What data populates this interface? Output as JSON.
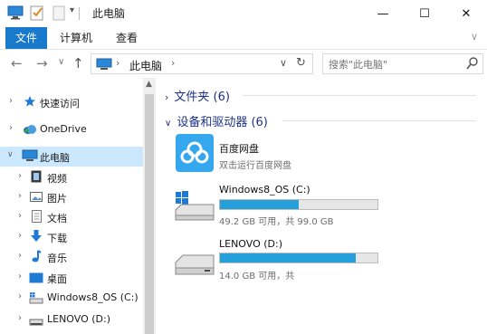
{
  "window": {
    "title": "此电脑",
    "controls": {
      "minimize": "—",
      "maximize": "☐",
      "close": "✕"
    }
  },
  "ribbon": {
    "tabs": [
      "文件",
      "计算机",
      "查看"
    ],
    "collapse_glyph": "∨"
  },
  "address": {
    "crumb": "此电脑",
    "search_placeholder": "搜索\"此电脑\""
  },
  "nav": {
    "items": [
      {
        "label": "快速访问",
        "icon": "star-icon",
        "selected": false
      },
      {
        "label": "OneDrive",
        "icon": "cloud-icon",
        "selected": false
      },
      {
        "label": "此电脑",
        "icon": "computer-icon",
        "selected": true
      },
      {
        "label": "视频",
        "icon": "video-icon",
        "selected": false
      },
      {
        "label": "图片",
        "icon": "picture-icon",
        "selected": false
      },
      {
        "label": "文档",
        "icon": "document-icon",
        "selected": false
      },
      {
        "label": "下载",
        "icon": "download-icon",
        "selected": false
      },
      {
        "label": "音乐",
        "icon": "music-icon",
        "selected": false
      },
      {
        "label": "桌面",
        "icon": "desktop-icon",
        "selected": false
      },
      {
        "label": "Windows8_OS (C:)",
        "icon": "drive-c-icon",
        "selected": false
      },
      {
        "label": "LENOVO (D:)",
        "icon": "drive-d-icon",
        "selected": false
      }
    ]
  },
  "groups": {
    "folders": {
      "label": "文件夹 (6)",
      "collapsed": true
    },
    "devices": {
      "label": "设备和驱动器 (6)",
      "collapsed": false
    }
  },
  "devices": [
    {
      "name": "百度网盘",
      "sub": "双击运行百度网盘",
      "icon": "baidu-cloud-icon"
    },
    {
      "name": "Windows8_OS (C:)",
      "sub": "49.2 GB 可用，共 99.0 GB",
      "icon": "windows-drive-icon",
      "usage": 0.5
    },
    {
      "name": "LENOVO (D:)",
      "sub": "14.0 GB 可用，共",
      "icon": "hard-drive-icon",
      "usage": 0.86
    }
  ],
  "colors": {
    "accent": "#1979ca",
    "selection": "#cce8ff",
    "bar_fill": "#26a0da",
    "group_header": "#1e3287"
  }
}
